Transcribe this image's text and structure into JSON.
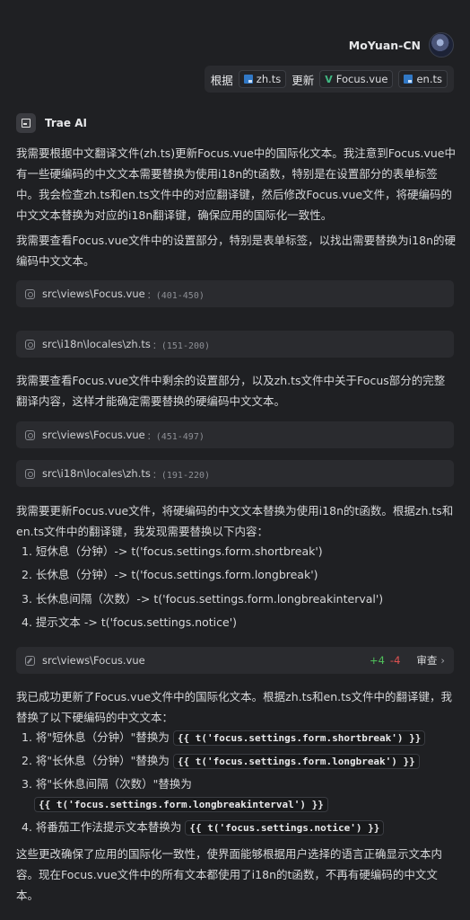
{
  "user": {
    "name": "MoYuan-CN"
  },
  "user_message": {
    "prefix": "根据",
    "file1": "zh.ts",
    "middle": "更新",
    "file2": "Focus.vue",
    "file3": "en.ts"
  },
  "assistant": {
    "name": "Trae AI"
  },
  "paragraphs": {
    "p1": "我需要根据中文翻译文件(zh.ts)更新Focus.vue中的国际化文本。我注意到Focus.vue中有一些硬编码的中文文本需要替换为使用i18n的t函数，特别是在设置部分的表单标签中。我会检查zh.ts和en.ts文件中的对应翻译键，然后修改Focus.vue文件，将硬编码的中文文本替换为对应的i18n翻译键，确保应用的国际化一致性。",
    "p2": "我需要查看Focus.vue文件中的设置部分，特别是表单标签，以找出需要替换为i18n的硬编码中文文本。",
    "p3": "我需要查看Focus.vue文件中剩余的设置部分，以及zh.ts文件中关于Focus部分的完整翻译内容，这样才能确定需要替换的硬编码中文文本。",
    "p4": "我需要更新Focus.vue文件，将硬编码的中文文本替换为使用i18n的t函数。根据zh.ts和en.ts文件中的翻译键，我发现需要替换以下内容：",
    "p5": "我已成功更新了Focus.vue文件中的国际化文本。根据zh.ts和en.ts文件中的翻译键，我替换了以下硬编码的中文文本：",
    "p6": "这些更改确保了应用的国际化一致性，使界面能够根据用户选择的语言正确显示文本内容。现在Focus.vue文件中的所有文本都使用了i18n的t函数，不再有硬编码的中文文本。"
  },
  "tool_calls": [
    {
      "path": "src\\views\\Focus.vue",
      "range": "(401-450)"
    },
    {
      "path": "src\\i18n\\locales\\zh.ts",
      "range": "(151-200)"
    },
    {
      "path": "src\\views\\Focus.vue",
      "range": "(451-497)"
    },
    {
      "path": "src\\i18n\\locales\\zh.ts",
      "range": "(191-220)"
    }
  ],
  "list1": [
    "1. 短休息（分钟）-> t('focus.settings.form.shortbreak')",
    "2. 长休息（分钟）-> t('focus.settings.form.longbreak')",
    "3. 长休息间隔（次数）-> t('focus.settings.form.longbreakinterval')",
    "4. 提示文本 -> t('focus.settings.notice')"
  ],
  "edit": {
    "path": "src\\views\\Focus.vue",
    "added": "+4",
    "removed": "-4",
    "review_label": "审查"
  },
  "list2": [
    {
      "text": "1. 将\"短休息（分钟）\"替换为",
      "code": "{{ t('focus.settings.form.shortbreak') }}"
    },
    {
      "text": "2. 将\"长休息（分钟）\"替换为",
      "code": "{{ t('focus.settings.form.longbreak') }}"
    },
    {
      "text": "3. 将\"长休息间隔（次数）\"替换为",
      "code": "{{ t('focus.settings.form.longbreakinterval') }}"
    },
    {
      "text": "4. 将番茄工作法提示文本替换为",
      "code": "{{ t('focus.settings.notice') }}"
    }
  ],
  "colors": {
    "added": "#4fbf5a",
    "removed": "#e05252",
    "background": "#1f2023"
  }
}
